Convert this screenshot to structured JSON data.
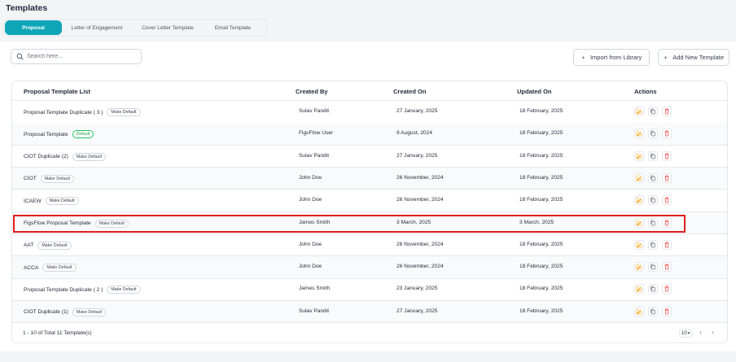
{
  "page": {
    "title": "Templates"
  },
  "tabs": [
    {
      "label": "Proposal",
      "active": true
    },
    {
      "label": "Letter of Engagement",
      "active": false
    },
    {
      "label": "Cover Letter Template",
      "active": false
    },
    {
      "label": "Email Template",
      "active": false
    }
  ],
  "toolbar": {
    "search_placeholder": "Search here...",
    "import_label": "Import from Library",
    "add_label": "Add New Template"
  },
  "table": {
    "columns": [
      "Proposal Template List",
      "Created By",
      "Created On",
      "Updated On",
      "Actions"
    ],
    "rows": [
      {
        "name": "Proposal Template Duplicate ( 3 )",
        "badge": "Make Default",
        "badge_default": false,
        "created_by": "Sulav Pandit",
        "created_on": "27 January, 2025",
        "updated_on": "18 February, 2025"
      },
      {
        "name": "Proposal Template",
        "badge": "Default",
        "badge_default": true,
        "created_by": "FigsFlow User",
        "created_on": "9 August, 2024",
        "updated_on": "18 February, 2025"
      },
      {
        "name": "CIOT Duplicate (2)",
        "badge": "Make Default",
        "badge_default": false,
        "created_by": "Sulav Pandit",
        "created_on": "27 January, 2025",
        "updated_on": "18 February, 2025"
      },
      {
        "name": "CIOT",
        "badge": "Make Default",
        "badge_default": false,
        "created_by": "John Doe",
        "created_on": "26 November, 2024",
        "updated_on": "18 February, 2025"
      },
      {
        "name": "ICAEW",
        "badge": "Make Default",
        "badge_default": false,
        "created_by": "John Doe",
        "created_on": "26 November, 2024",
        "updated_on": "18 February, 2025"
      },
      {
        "name": "FigsFlow Proposal Template",
        "badge": "Make Default",
        "badge_default": false,
        "created_by": "James Smith",
        "created_on": "3 March, 2025",
        "updated_on": "3 March, 2025"
      },
      {
        "name": "AAT",
        "badge": "Make Default",
        "badge_default": false,
        "created_by": "John Doe",
        "created_on": "26 November, 2024",
        "updated_on": "18 February, 2025"
      },
      {
        "name": "ACCA",
        "badge": "Make Default",
        "badge_default": false,
        "created_by": "John Doe",
        "created_on": "26 November, 2024",
        "updated_on": "18 February, 2025"
      },
      {
        "name": "Proposal Template Duplicate ( 2 )",
        "badge": "Make Default",
        "badge_default": false,
        "created_by": "James Smith",
        "created_on": "23 January, 2025",
        "updated_on": "18 February, 2025"
      },
      {
        "name": "CIOT Duplicate (1)",
        "badge": "Make Default",
        "badge_default": false,
        "created_by": "Sulav Pandit",
        "created_on": "27 January, 2025",
        "updated_on": "18 February, 2025"
      }
    ],
    "footer_text": "1 - 10 of Total 11 Template(s)",
    "page_size": "10",
    "highlighted_row": 5
  },
  "icons": {
    "search": "search-icon",
    "edit": "edit-icon",
    "copy": "copy-icon",
    "delete": "delete-icon",
    "plus": "plus-icon"
  },
  "colors": {
    "accent": "#0ea5b7",
    "edit": "#f59e0b",
    "delete": "#ef4444",
    "highlight": "#e11d1d",
    "default_badge": "#16a34a"
  }
}
